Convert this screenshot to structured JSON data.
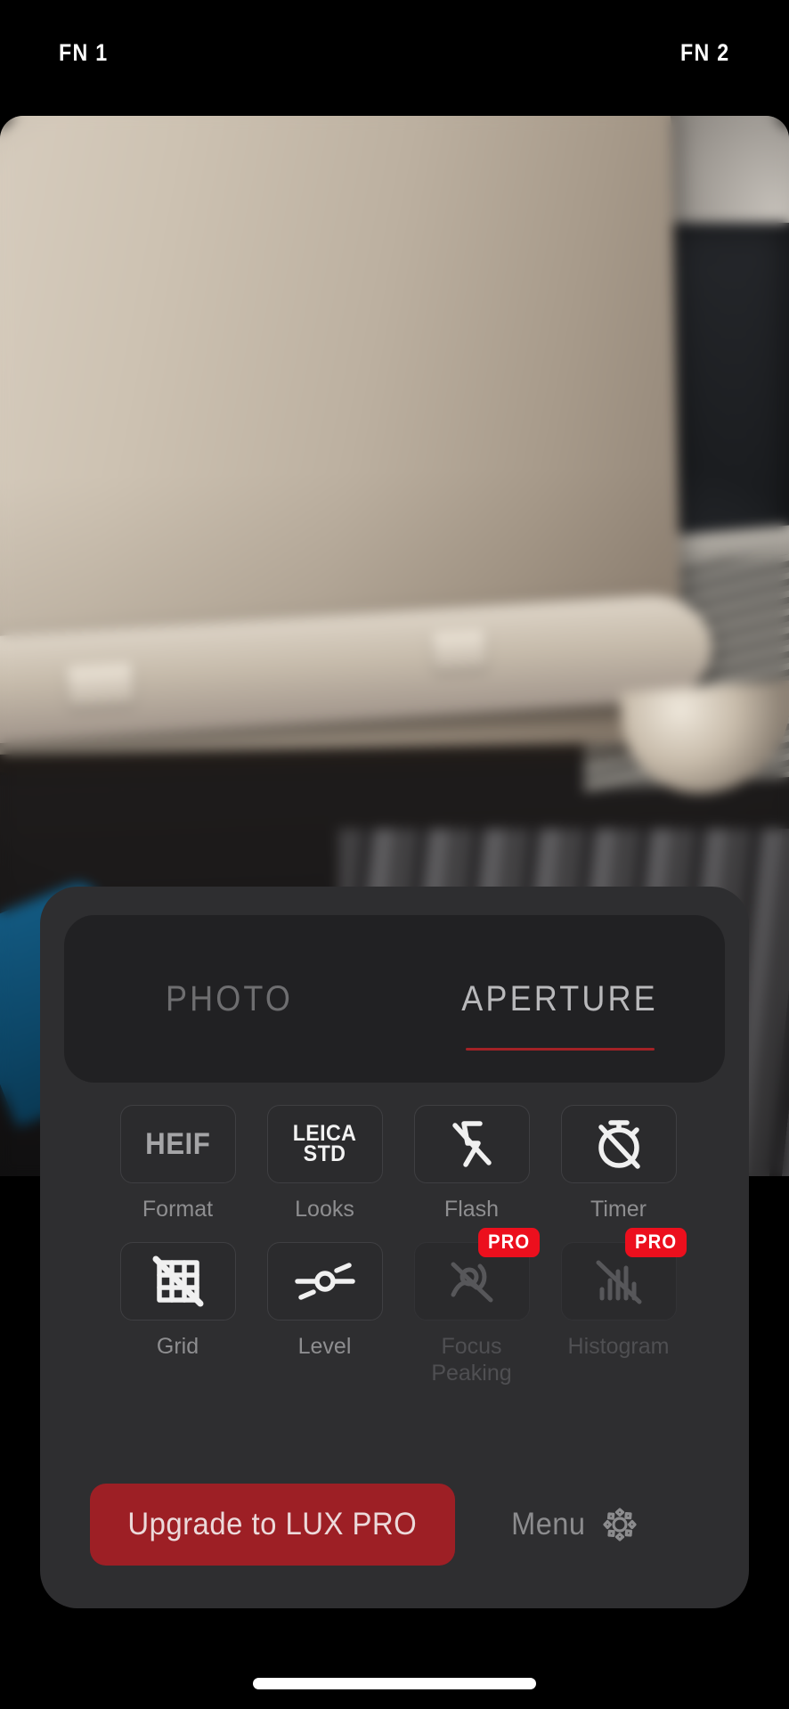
{
  "app": {
    "accent_red": "#a32226",
    "badge_red": "#ec0f1d",
    "upgrade_button_red": "#9d1f25",
    "panel_bg": "#2e2e30",
    "tab_track_bg": "#212123"
  },
  "top_bar": {
    "fn1_label": "FN 1",
    "fn2_label": "FN 2"
  },
  "viewfinder": {
    "description": "blurred photo of a train interior: cream seat back, window, radiator vent, dark floor"
  },
  "mode_tabs": {
    "items": [
      {
        "label": "PHOTO",
        "selected": false
      },
      {
        "label": "APERTURE",
        "selected": true
      }
    ]
  },
  "tools": [
    {
      "label": "Format",
      "value": "HEIF",
      "icon": "heif-text",
      "enabled": true,
      "pro": null
    },
    {
      "label": "Looks",
      "value": "LEICA STD",
      "icon": "leica-std-text",
      "enabled": true,
      "pro": null
    },
    {
      "label": "Flash",
      "value": "",
      "icon": "flash-off-icon",
      "enabled": true,
      "pro": null
    },
    {
      "label": "Timer",
      "value": "",
      "icon": "timer-off-icon",
      "enabled": true,
      "pro": null
    },
    {
      "label": "Grid",
      "value": "",
      "icon": "grid-off-icon",
      "enabled": true,
      "pro": null
    },
    {
      "label": "Level",
      "value": "",
      "icon": "level-icon",
      "enabled": true,
      "pro": null
    },
    {
      "label": "Focus Peaking",
      "value": "",
      "icon": "focus-peaking-off-icon",
      "enabled": false,
      "pro": "PRO"
    },
    {
      "label": "Histogram",
      "value": "",
      "icon": "histogram-off-icon",
      "enabled": false,
      "pro": "PRO"
    }
  ],
  "leica_line1": "LEICA",
  "leica_line2": "STD",
  "footer": {
    "upgrade_label": "Upgrade to LUX PRO",
    "menu_label": "Menu",
    "menu_icon": "gear-icon"
  }
}
